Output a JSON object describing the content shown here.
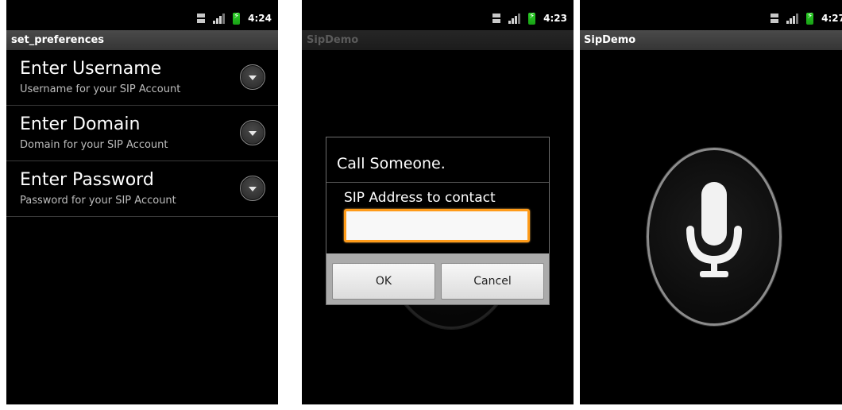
{
  "screens": [
    {
      "status_time": "4:24",
      "title": "set_preferences",
      "preferences": [
        {
          "title": "Enter Username",
          "summary": "Username for your SIP Account"
        },
        {
          "title": "Enter Domain",
          "summary": "Domain for your SIP Account"
        },
        {
          "title": "Enter Password",
          "summary": "Password for your SIP Account"
        }
      ]
    },
    {
      "status_time": "4:23",
      "title": "SipDemo",
      "dialog": {
        "title": "Call Someone.",
        "label": "SIP Address to contact",
        "input_value": "",
        "ok_label": "OK",
        "cancel_label": "Cancel"
      }
    },
    {
      "status_time": "4:27",
      "title": "SipDemo"
    }
  ],
  "icons": {
    "network": "3g-icon",
    "signal": "signal-icon",
    "battery": "battery-charging-icon",
    "pref_arrow": "chevron-down-icon",
    "mic": "microphone-icon"
  },
  "colors": {
    "input_focus": "#ff9b19",
    "battery": "#2dcf28"
  }
}
